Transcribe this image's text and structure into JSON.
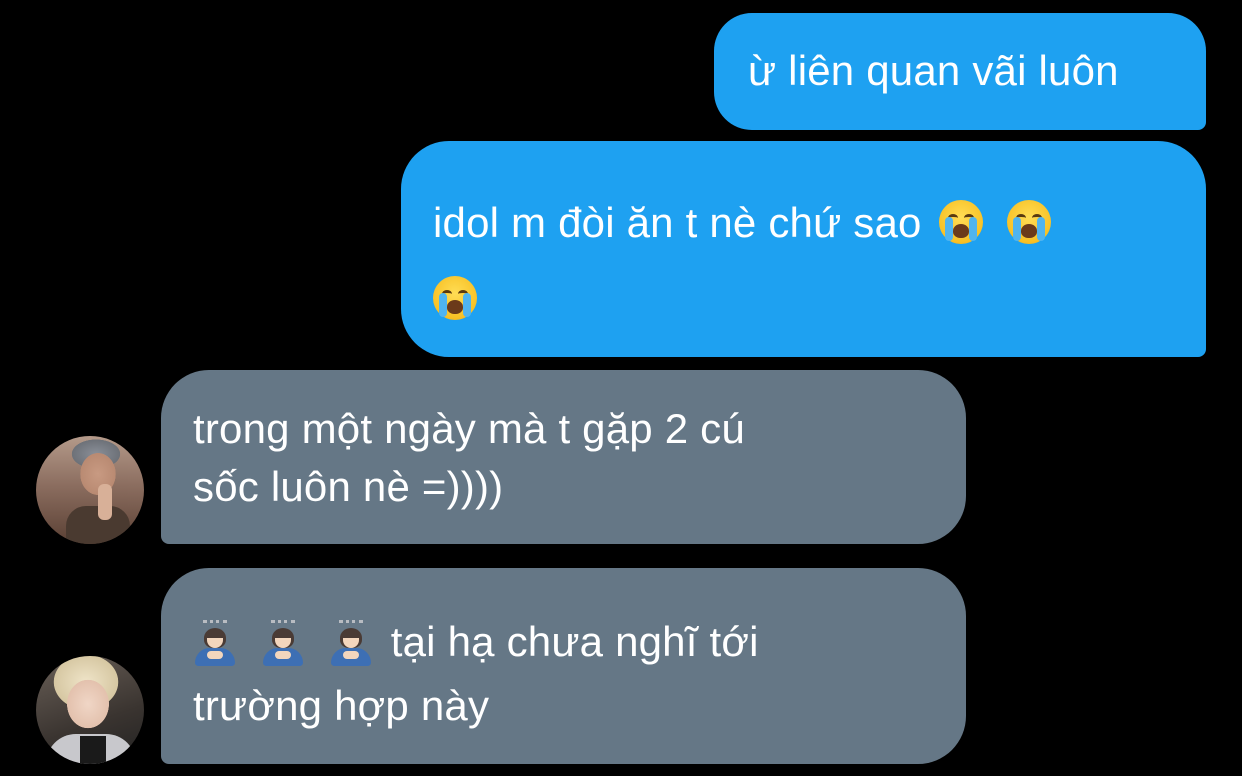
{
  "messages": [
    {
      "id": "msg1",
      "direction": "outgoing",
      "text": "ừ liên quan vãi luôn"
    },
    {
      "id": "msg2",
      "direction": "outgoing",
      "text": "idol m đòi ăn t nè chứ sao",
      "emojis": [
        "loudly-crying-face",
        "loudly-crying-face",
        "loudly-crying-face"
      ]
    },
    {
      "id": "msg3",
      "direction": "incoming",
      "line1": "trong một ngày mà t gặp 2 cú",
      "line2": "sốc luôn nè =))))"
    },
    {
      "id": "msg4",
      "direction": "incoming",
      "emojis": [
        "person-bowing",
        "person-bowing",
        "person-bowing"
      ],
      "line1": "tại hạ chưa nghĩ tới",
      "line2": "trường hợp này"
    }
  ],
  "colors": {
    "background": "#000000",
    "outgoing_bubble": "#1ea1f1",
    "incoming_bubble": "#657786",
    "text": "#ffffff"
  }
}
